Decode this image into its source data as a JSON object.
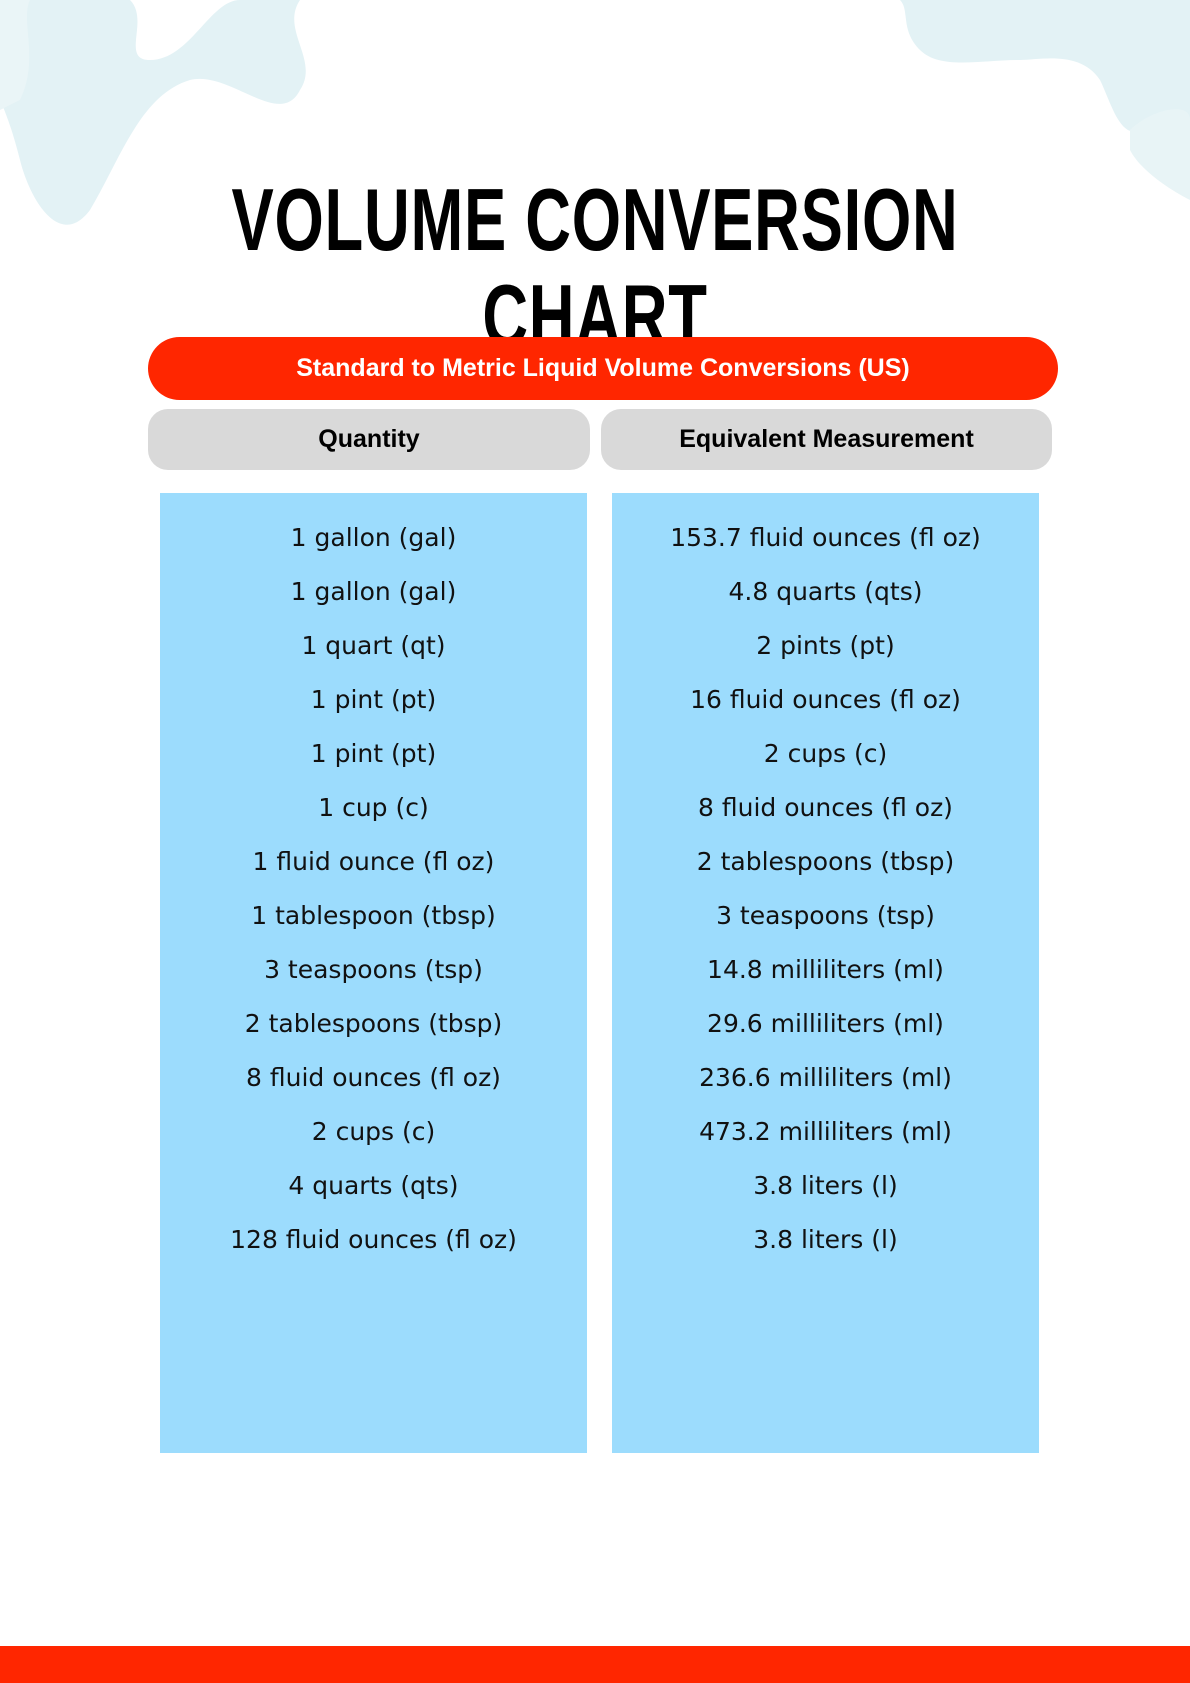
{
  "title": "VOLUME CONVERSION CHART",
  "subtitle": "Standard to Metric Liquid Volume Conversions (US)",
  "columns": {
    "quantity_header": "Quantity",
    "equivalent_header": "Equivalent Measurement"
  },
  "rows": [
    {
      "quantity": "1 gallon (gal)",
      "equivalent": "153.7 fluid ounces (fl oz)"
    },
    {
      "quantity": "1 gallon (gal)",
      "equivalent": "4.8 quarts (qts)"
    },
    {
      "quantity": "1 quart (qt)",
      "equivalent": "2 pints (pt)"
    },
    {
      "quantity": "1 pint (pt)",
      "equivalent": "16 fluid ounces (fl oz)"
    },
    {
      "quantity": "1 pint (pt)",
      "equivalent": "2 cups (c)"
    },
    {
      "quantity": "1 cup (c)",
      "equivalent": "8 fluid ounces (fl oz)"
    },
    {
      "quantity": "1 fluid ounce (fl oz)",
      "equivalent": "2 tablespoons (tbsp)"
    },
    {
      "quantity": "1 tablespoon (tbsp)",
      "equivalent": "3 teaspoons (tsp)"
    },
    {
      "quantity": "3 teaspoons (tsp)",
      "equivalent": "14.8 milliliters (ml)"
    },
    {
      "quantity": "2 tablespoons (tbsp)",
      "equivalent": "29.6 milliliters (ml)"
    },
    {
      "quantity": "8 fluid ounces (fl oz)",
      "equivalent": "236.6 milliliters (ml)"
    },
    {
      "quantity": "2 cups (c)",
      "equivalent": "473.2 milliliters (ml)"
    },
    {
      "quantity": "4 quarts (qts)",
      "equivalent": "3.8 liters (l)"
    },
    {
      "quantity": "128 fluid ounces (fl oz)",
      "equivalent": "3.8 liters (l)"
    }
  ],
  "colors": {
    "accent_red": "#ff2600",
    "header_gray": "#d9d9d9",
    "panel_blue": "#9cdcfd",
    "decor_blue": "#e3f2f5"
  }
}
